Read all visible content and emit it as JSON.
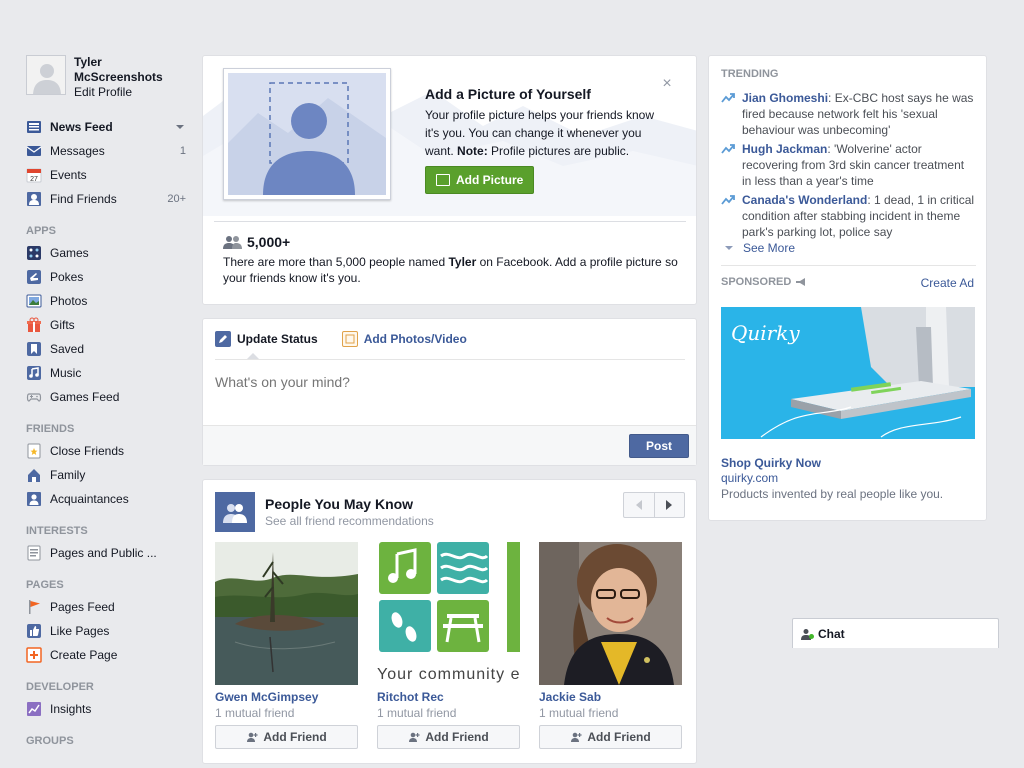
{
  "profile": {
    "name": "Tyler McScreenshots",
    "edit_label": "Edit Profile"
  },
  "nav": {
    "main": [
      {
        "label": "News Feed",
        "icon": "news-feed-icon",
        "count": ""
      },
      {
        "label": "Messages",
        "icon": "messages-icon",
        "count": "1"
      },
      {
        "label": "Events",
        "icon": "events-icon",
        "count": ""
      },
      {
        "label": "Find Friends",
        "icon": "find-friends-icon",
        "count": "20+"
      }
    ],
    "apps_head": "APPS",
    "apps": [
      {
        "label": "Games",
        "icon": "games-icon"
      },
      {
        "label": "Pokes",
        "icon": "pokes-icon"
      },
      {
        "label": "Photos",
        "icon": "photos-icon"
      },
      {
        "label": "Gifts",
        "icon": "gifts-icon"
      },
      {
        "label": "Saved",
        "icon": "saved-icon"
      },
      {
        "label": "Music",
        "icon": "music-icon"
      },
      {
        "label": "Games Feed",
        "icon": "games-feed-icon"
      }
    ],
    "friends_head": "FRIENDS",
    "friends": [
      {
        "label": "Close Friends",
        "icon": "close-friends-icon"
      },
      {
        "label": "Family",
        "icon": "family-icon"
      },
      {
        "label": "Acquaintances",
        "icon": "acquaintances-icon"
      }
    ],
    "interests_head": "INTERESTS",
    "interests": [
      {
        "label": "Pages and Public ...",
        "icon": "pages-public-icon"
      }
    ],
    "pages_head": "PAGES",
    "pages": [
      {
        "label": "Pages Feed",
        "icon": "pages-feed-icon"
      },
      {
        "label": "Like Pages",
        "icon": "like-pages-icon"
      },
      {
        "label": "Create Page",
        "icon": "create-page-icon"
      }
    ],
    "developer_head": "DEVELOPER",
    "developer": [
      {
        "label": "Insights",
        "icon": "insights-icon"
      }
    ],
    "groups_head": "GROUPS"
  },
  "add_picture": {
    "title": "Add a Picture of Yourself",
    "desc": "Your profile picture helps your friends know it's you. You can change it whenever you want.",
    "note_label": "Note:",
    "note_text": " Profile pictures are public.",
    "button": "Add Picture",
    "count": "5,000+",
    "count_pre": "There are more than 5,000 people named ",
    "count_name": "Tyler",
    "count_post": " on Facebook. Add a profile picture so your friends know it's you."
  },
  "composer": {
    "tab_status": "Update Status",
    "tab_photos": "Add Photos/Video",
    "placeholder": "What's on your mind?",
    "post_label": "Post"
  },
  "pymk": {
    "title": "People You May Know",
    "subtitle": "See all friend recommendations",
    "people": [
      {
        "name": "Gwen McGimpsey",
        "mutual": "1 mutual friend",
        "button": "Add Friend"
      },
      {
        "name": "Ritchot Rec",
        "mutual": "1 mutual friend",
        "button": "Add Friend",
        "photo_text": "Your community e"
      },
      {
        "name": "Jackie Sab",
        "mutual": "1 mutual friend",
        "button": "Add Friend"
      }
    ]
  },
  "trending": {
    "head": "TRENDING",
    "items": [
      {
        "topic": "Jian Ghomeshi",
        "text": ": Ex-CBC host says he was fired because network felt his 'sexual behaviour was unbecoming'"
      },
      {
        "topic": "Hugh Jackman",
        "text": ": 'Wolverine' actor recovering from 3rd skin cancer treatment in less than a year's time"
      },
      {
        "topic": "Canada's Wonderland",
        "text": ": 1 dead, 1 in critical condition after stabbing incident in theme park's parking lot, police say"
      }
    ],
    "see_more": "See More"
  },
  "sponsored": {
    "head": "SPONSORED",
    "create_ad": "Create Ad",
    "ad_brand": "Quirky",
    "ad_title": "Shop Quirky Now",
    "ad_url": "quirky.com",
    "ad_desc": "Products invented by real people like you."
  },
  "chat": {
    "label": "Chat"
  },
  "colors": {
    "brand": "#3b5998",
    "button_blue": "#4e69a2",
    "button_green": "#5aa02c",
    "background": "#e9eaed"
  }
}
